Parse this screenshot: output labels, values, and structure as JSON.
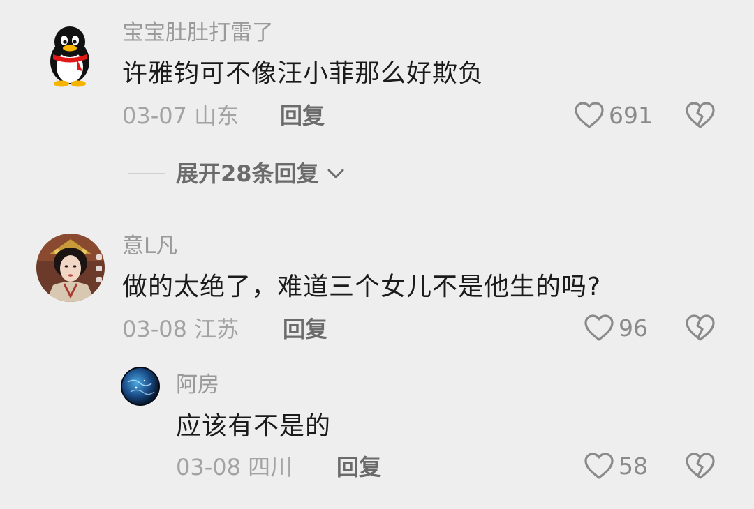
{
  "comments": [
    {
      "username": "宝宝肚肚打雷了",
      "text": "许雅钧可不像汪小菲那么好欺负",
      "date": "03-07 山东",
      "reply": "回复",
      "likes": "691",
      "avatar_icon": "qq-penguin"
    },
    {
      "username": "意L凡",
      "text": "做的太绝了，难道三个女儿不是他生的吗?",
      "date": "03-08 江苏",
      "reply": "回复",
      "likes": "96",
      "avatar_icon": "portrait-photo"
    },
    {
      "username": "阿房",
      "text": "应该有不是的",
      "date": "03-08 四川",
      "reply": "回复",
      "likes": "58",
      "avatar_icon": "earth-globe"
    }
  ],
  "expand_replies": "展开28条回复",
  "icons": {
    "like": "heart-outline-icon",
    "dislike": "broken-heart-icon",
    "expand": "chevron-down-icon"
  },
  "colors": {
    "background": "#eeeeee",
    "username": "#9a9a9a",
    "meta": "#a3a3a3",
    "action": "#6b6b6b"
  }
}
